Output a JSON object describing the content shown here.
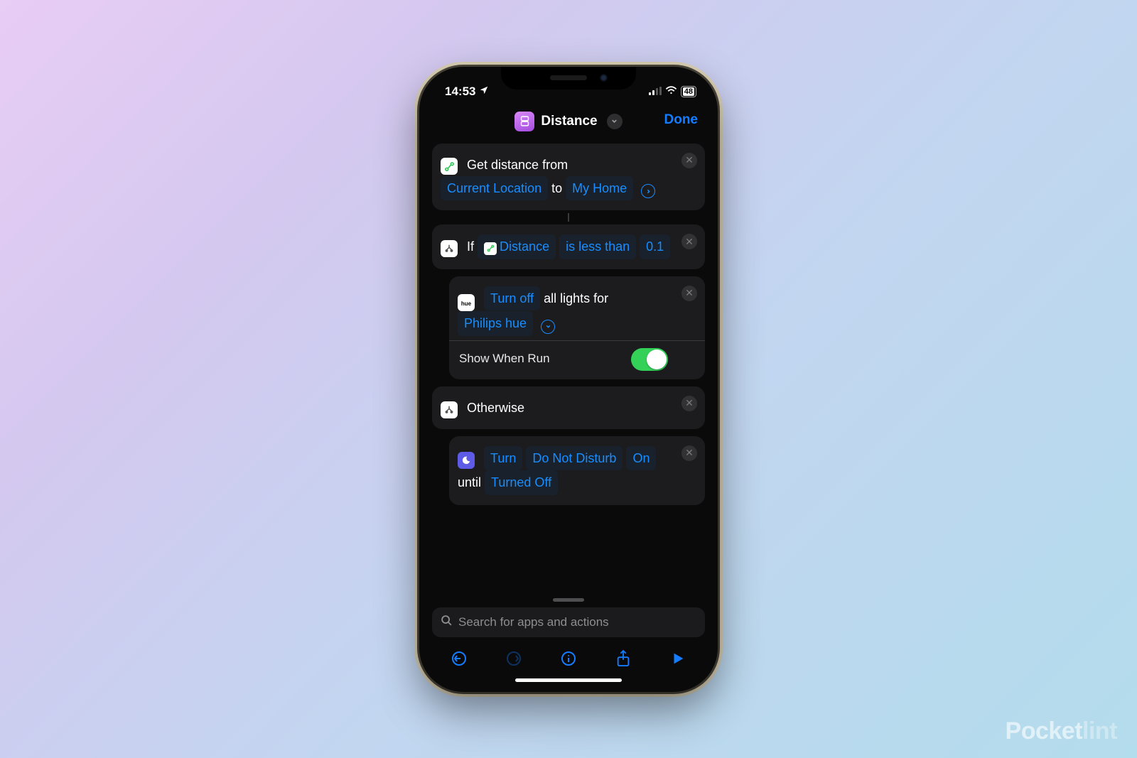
{
  "status": {
    "time": "14:53",
    "battery": "48"
  },
  "nav": {
    "title": "Distance",
    "done": "Done"
  },
  "actions": {
    "a1": {
      "label": "Get distance from",
      "from": "Current Location",
      "to_label": "to",
      "to": "My Home"
    },
    "a2": {
      "if": "If",
      "var": "Distance",
      "cond": "is less than",
      "val": "0.1"
    },
    "a3": {
      "cmd": "Turn off",
      "rest": "all lights for",
      "target": "Philips hue",
      "toggle_label": "Show When Run"
    },
    "a4": {
      "label": "Otherwise"
    },
    "a5": {
      "cmd": "Turn",
      "mode": "Do Not Disturb",
      "state": "On",
      "until": "until",
      "end": "Turned Off"
    }
  },
  "search": {
    "placeholder": "Search for apps and actions"
  },
  "watermark": {
    "a": "Pocket",
    "b": "lint"
  }
}
